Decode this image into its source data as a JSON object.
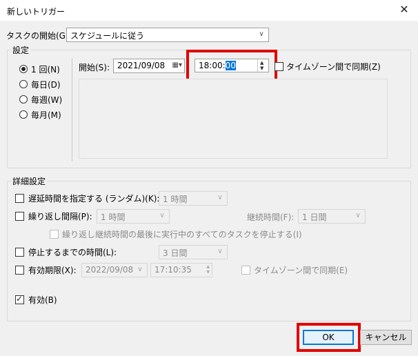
{
  "window": {
    "title": "新しいトリガー"
  },
  "task_start": {
    "label": "タスクの開始(G):",
    "value": "スケジュールに従う"
  },
  "settings": {
    "group_label": "設定",
    "frequency_options": [
      {
        "label": "1 回(N)",
        "selected": true
      },
      {
        "label": "毎日(D)",
        "selected": false
      },
      {
        "label": "毎週(W)",
        "selected": false
      },
      {
        "label": "毎月(M)",
        "selected": false
      }
    ],
    "start_label": "開始(S):",
    "start_date": "2021/09/08",
    "start_time_prefix": "18:00:",
    "start_time_selected": "00",
    "sync_timezone_label": "タイムゾーン間で同期(Z)"
  },
  "advanced": {
    "group_label": "詳細設定",
    "delay": {
      "label": "遅延時間を指定する (ランダム)(K):",
      "value": "1 時間"
    },
    "repeat": {
      "label": "繰り返し間隔(P):",
      "value": "1 時間",
      "duration_label": "継続時間(F):",
      "duration_value": "1 日間"
    },
    "stop_all": {
      "label": "繰り返し継続時間の最後に実行中のすべてのタスクを停止する(I)"
    },
    "stop_after": {
      "label": "停止するまでの時間(L):",
      "value": "3 日間"
    },
    "expire": {
      "label": "有効期限(X):",
      "date": "2022/09/08",
      "time": "17:10:35",
      "sync_label": "タイムゾーン間で同期(E)"
    },
    "enabled": {
      "label": "有効(B)"
    }
  },
  "buttons": {
    "ok": "OK",
    "cancel": "キャンセル"
  }
}
